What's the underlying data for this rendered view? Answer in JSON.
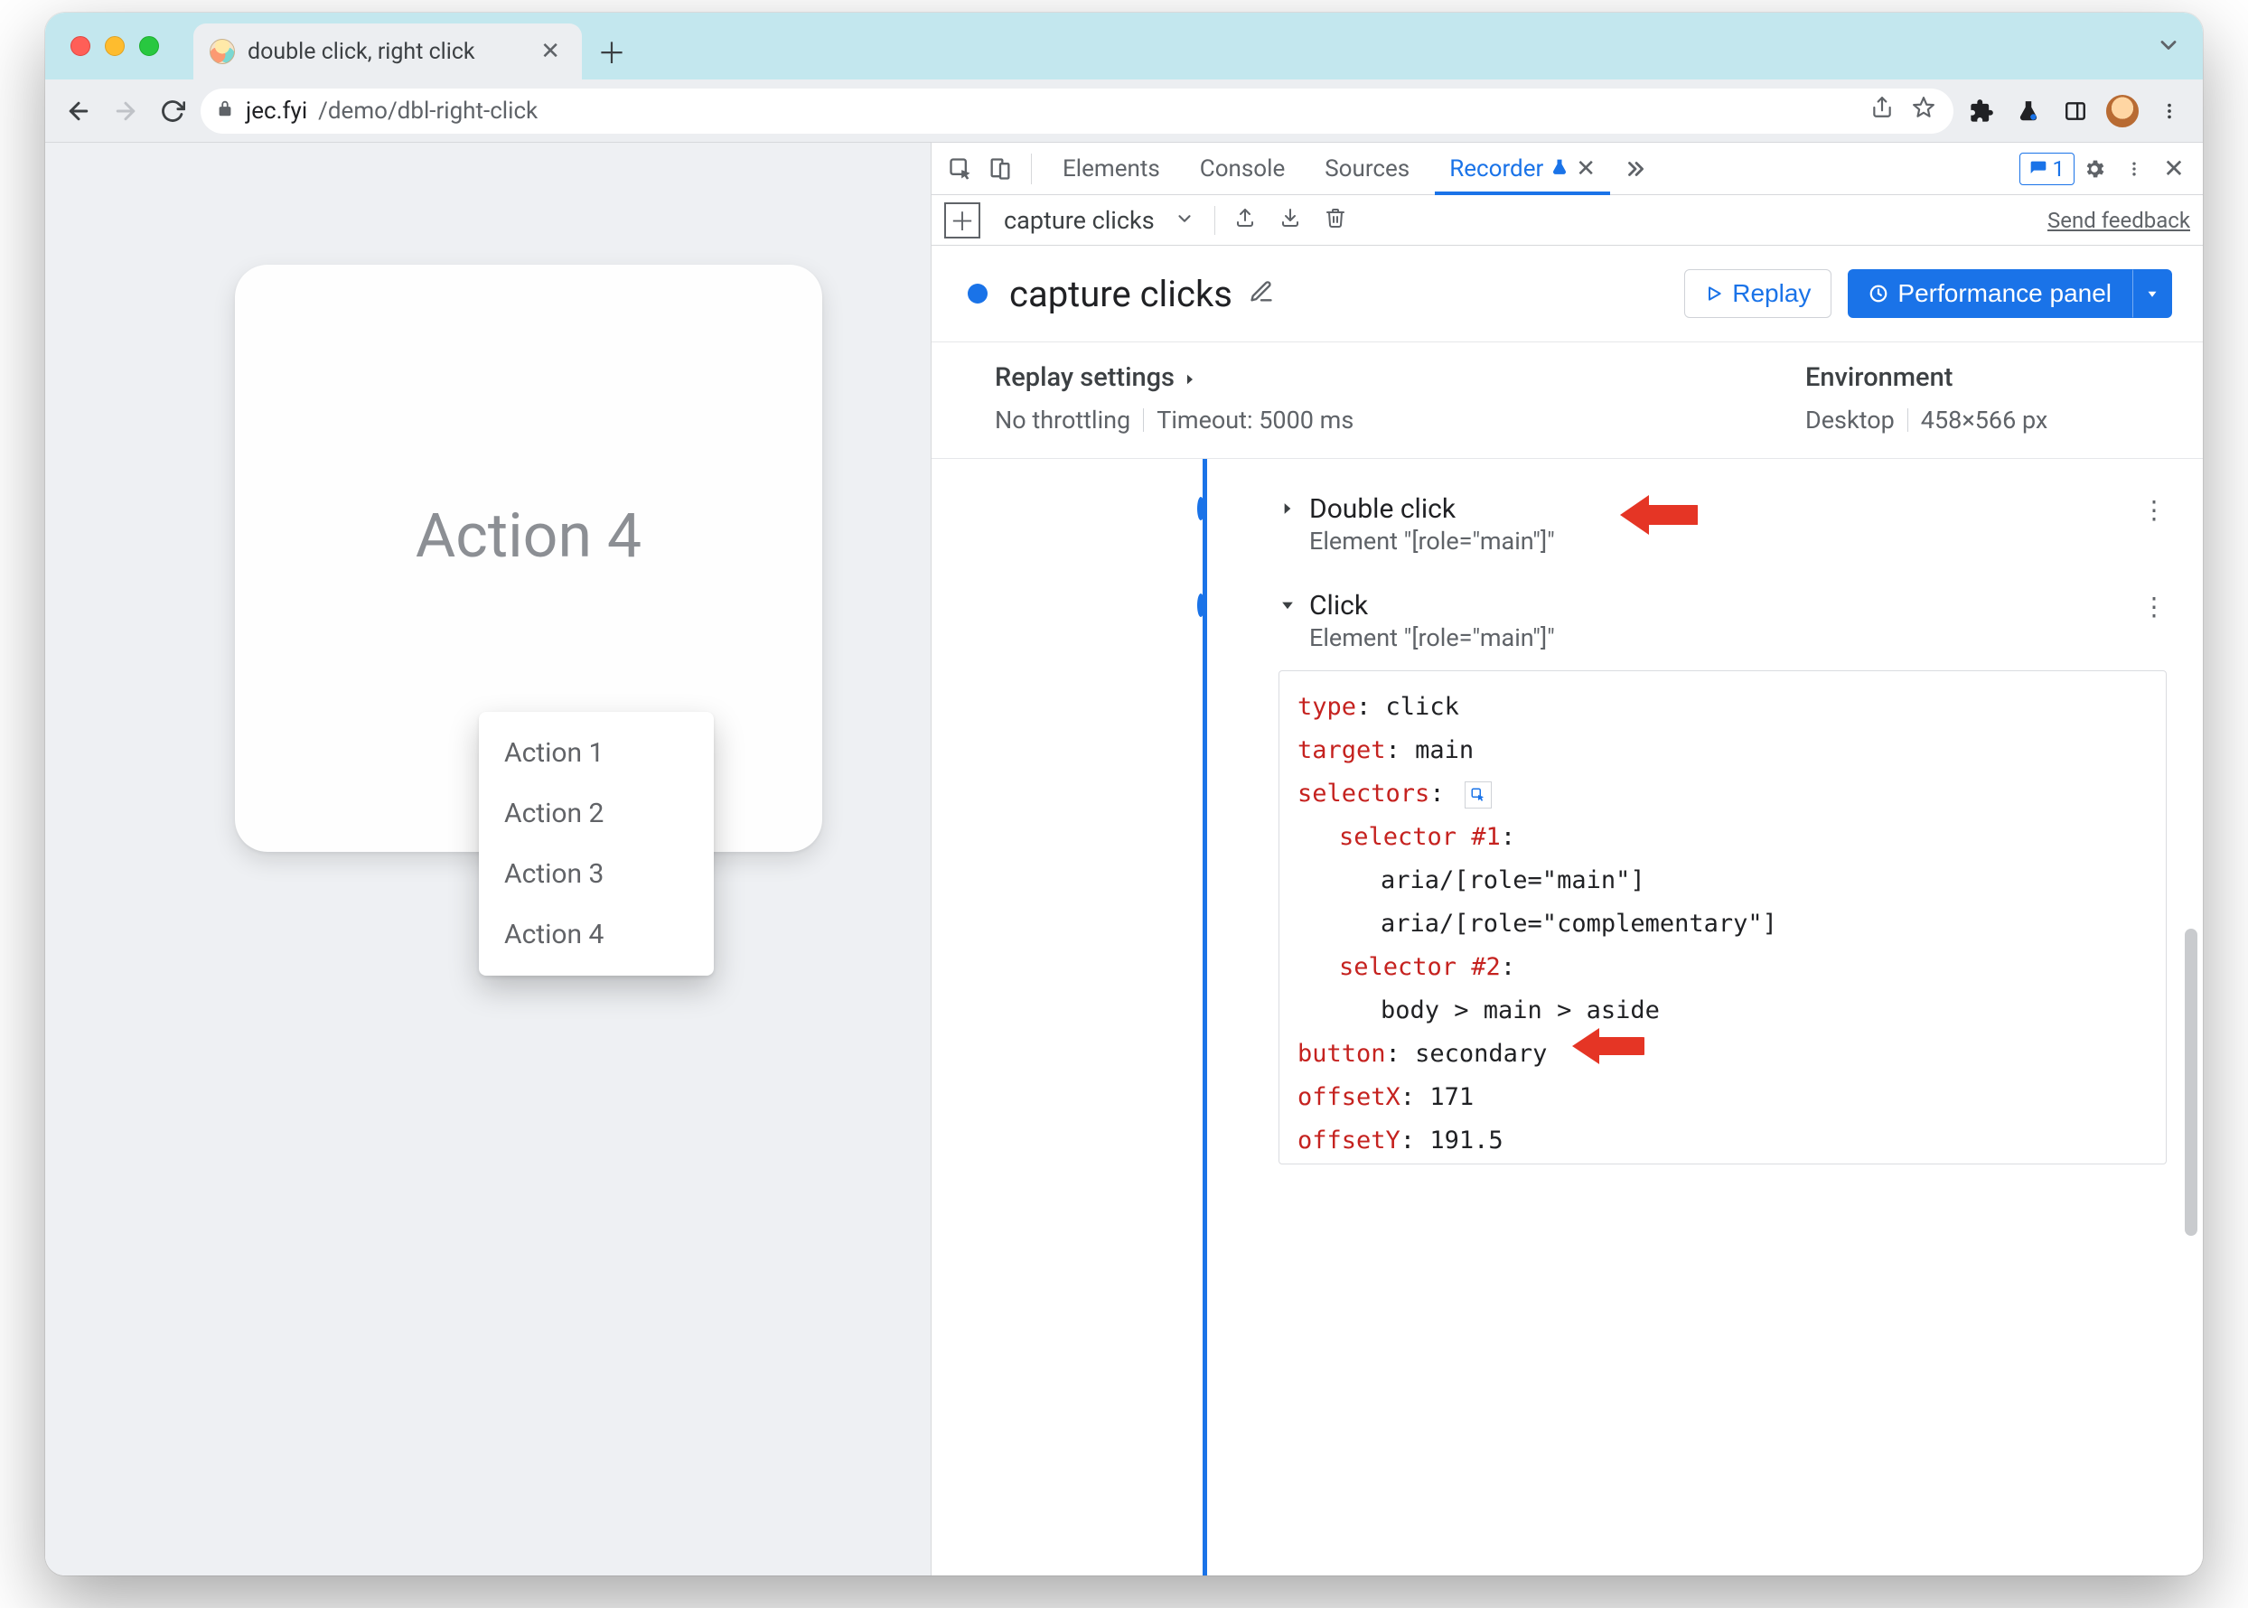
{
  "browser": {
    "tab_title": "double click, right click",
    "url_host": "jec.fyi",
    "url_path": "/demo/dbl-right-click"
  },
  "page": {
    "card_title": "Action 4",
    "context_menu": [
      "Action 1",
      "Action 2",
      "Action 3",
      "Action 4"
    ]
  },
  "devtools": {
    "tabs": {
      "elements": "Elements",
      "console": "Console",
      "sources": "Sources",
      "recorder": "Recorder"
    },
    "issues_count": "1",
    "subbar": {
      "recording_name": "capture clicks",
      "feedback": "Send feedback"
    },
    "header": {
      "title": "capture clicks",
      "replay": "Replay",
      "perf": "Performance panel"
    },
    "settings": {
      "replay_heading": "Replay settings",
      "throttling": "No throttling",
      "timeout": "Timeout: 5000 ms",
      "env_heading": "Environment",
      "device": "Desktop",
      "viewport": "458×566 px"
    },
    "steps": [
      {
        "title": "Double click",
        "subtitle": "Element \"[role=\"main\"]\"",
        "expanded": false
      },
      {
        "title": "Click",
        "subtitle": "Element \"[role=\"main\"]\"",
        "expanded": true
      }
    ],
    "detail": {
      "type_k": "type",
      "type_v": "click",
      "target_k": "target",
      "target_v": "main",
      "selectors_k": "selectors",
      "sel1_k": "selector #1",
      "sel1_a": "aria/[role=\"main\"]",
      "sel1_b": "aria/[role=\"complementary\"]",
      "sel2_k": "selector #2",
      "sel2_a": "body > main > aside",
      "button_k": "button",
      "button_v": "secondary",
      "offx_k": "offsetX",
      "offx_v": "171",
      "offy_k": "offsetY",
      "offy_v": "191.5"
    }
  }
}
